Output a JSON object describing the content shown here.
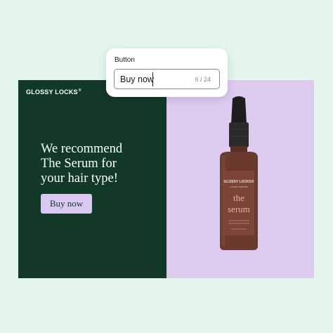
{
  "ad": {
    "brand": "GLOSSY LOCKS",
    "brand_mark": "®",
    "headline": "We recommend\nThe Serum for\nyour hair type!",
    "cta_label": "Buy now",
    "product": {
      "label_brand": "GLOSSY LOCKS®",
      "label_sub": "LUXURY SERUMS",
      "label_name_line1": "the",
      "label_name_line2": "serum"
    }
  },
  "editor": {
    "label": "Button",
    "value": "Buy now",
    "counter": "6 / 24"
  },
  "colors": {
    "background": "#e3f7ec",
    "ad_left": "#123828",
    "ad_right": "#decbf0",
    "cta_bg": "#d9c8f2",
    "bottle": "#6b3a2e"
  }
}
